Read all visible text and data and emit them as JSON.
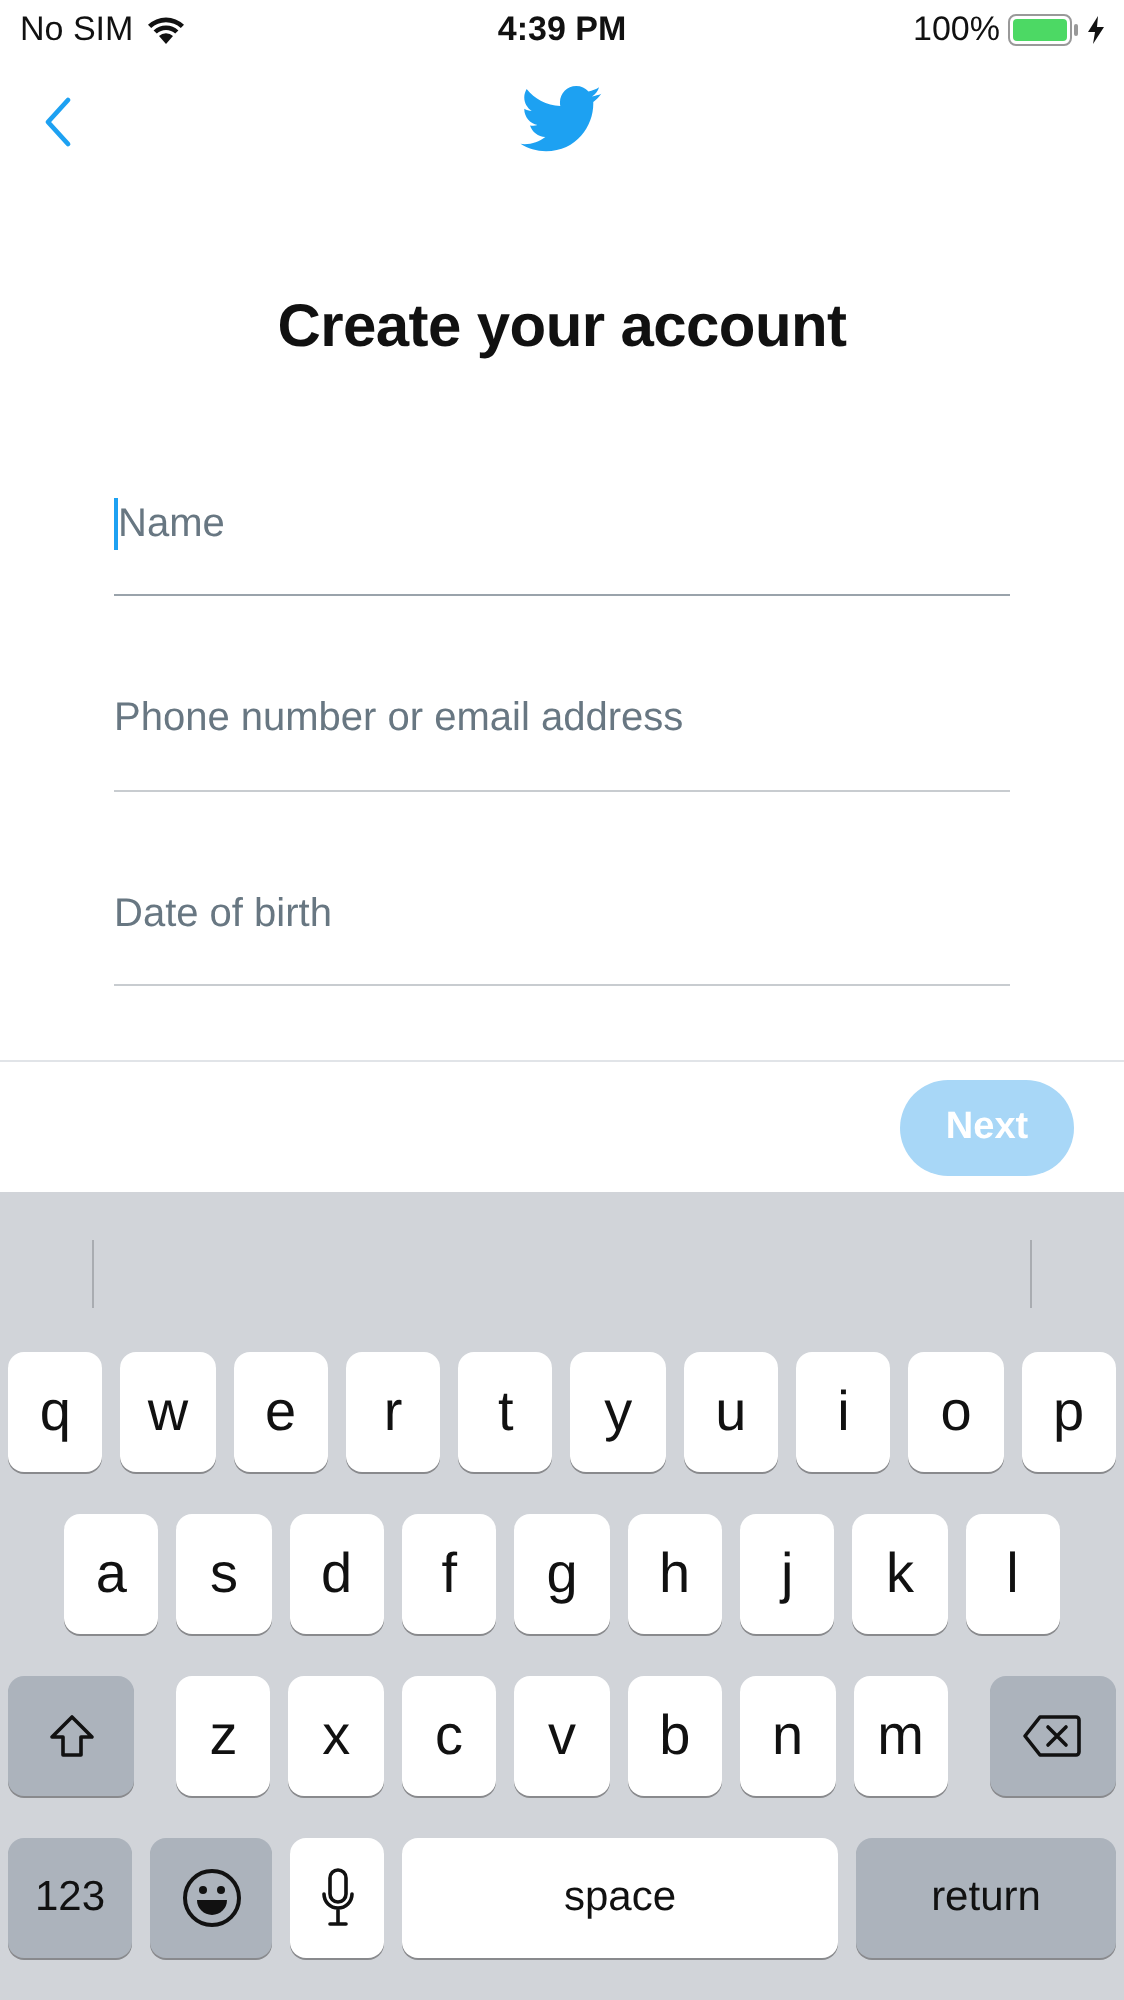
{
  "status_bar": {
    "carrier": "No SIM",
    "time": "4:39 PM",
    "battery": "100%",
    "charging": true
  },
  "title": "Create your account",
  "fields": [
    {
      "placeholder": "Name",
      "focused": true
    },
    {
      "placeholder": "Phone number or email address",
      "focused": false
    },
    {
      "placeholder": "Date of birth",
      "focused": false
    }
  ],
  "next_button": {
    "label": "Next",
    "disabled": true
  },
  "keyboard": {
    "rows": [
      {
        "keys": [
          {
            "kind": "letter",
            "label": "q"
          },
          {
            "kind": "letter",
            "label": "w"
          },
          {
            "kind": "letter",
            "label": "e"
          },
          {
            "kind": "letter",
            "label": "r"
          },
          {
            "kind": "letter",
            "label": "t"
          },
          {
            "kind": "letter",
            "label": "y"
          },
          {
            "kind": "letter",
            "label": "u"
          },
          {
            "kind": "letter",
            "label": "i"
          },
          {
            "kind": "letter",
            "label": "o"
          },
          {
            "kind": "letter",
            "label": "p"
          }
        ]
      },
      {
        "keys": [
          {
            "kind": "letter",
            "label": "a"
          },
          {
            "kind": "letter",
            "label": "s"
          },
          {
            "kind": "letter",
            "label": "d"
          },
          {
            "kind": "letter",
            "label": "f"
          },
          {
            "kind": "letter",
            "label": "g"
          },
          {
            "kind": "letter",
            "label": "h"
          },
          {
            "kind": "letter",
            "label": "j"
          },
          {
            "kind": "letter",
            "label": "k"
          },
          {
            "kind": "letter",
            "label": "l"
          }
        ]
      },
      {
        "keys": [
          {
            "kind": "shift"
          },
          {
            "kind": "letter",
            "label": "z"
          },
          {
            "kind": "letter",
            "label": "x"
          },
          {
            "kind": "letter",
            "label": "c"
          },
          {
            "kind": "letter",
            "label": "v"
          },
          {
            "kind": "letter",
            "label": "b"
          },
          {
            "kind": "letter",
            "label": "n"
          },
          {
            "kind": "letter",
            "label": "m"
          },
          {
            "kind": "delete"
          }
        ]
      },
      {
        "keys": [
          {
            "kind": "numbers",
            "label": "123"
          },
          {
            "kind": "emoji"
          },
          {
            "kind": "mic"
          },
          {
            "kind": "space",
            "label": "space"
          },
          {
            "kind": "return",
            "label": "return"
          }
        ]
      }
    ]
  }
}
